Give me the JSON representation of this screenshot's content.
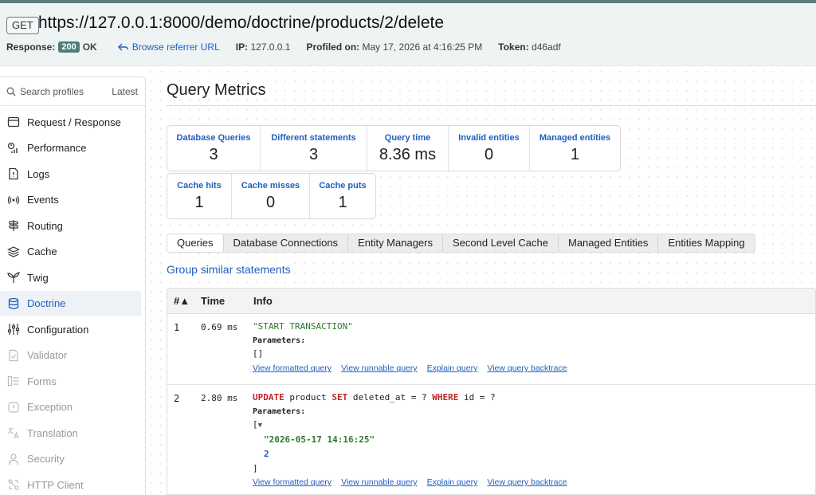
{
  "header": {
    "method": "GET",
    "url": "https://127.0.0.1:8000/demo/doctrine/products/2/delete",
    "response_label": "Response:",
    "status_code": "200",
    "status_text": "OK",
    "referrer_link": "Browse referrer URL",
    "ip_label": "IP:",
    "ip_value": "127.0.0.1",
    "profiled_label": "Profiled on:",
    "profiled_value": "May 17, 2026 at 4:16:25 PM",
    "token_label": "Token:",
    "token_value": "d46adf"
  },
  "sidebar": {
    "search_placeholder": "Search profiles",
    "latest": "Latest",
    "items": [
      {
        "label": "Request / Response",
        "icon": "request-icon",
        "state": "normal"
      },
      {
        "label": "Performance",
        "icon": "performance-icon",
        "state": "normal"
      },
      {
        "label": "Logs",
        "icon": "logs-icon",
        "state": "normal"
      },
      {
        "label": "Events",
        "icon": "events-icon",
        "state": "normal"
      },
      {
        "label": "Routing",
        "icon": "routing-icon",
        "state": "normal"
      },
      {
        "label": "Cache",
        "icon": "cache-icon",
        "state": "normal"
      },
      {
        "label": "Twig",
        "icon": "twig-icon",
        "state": "normal"
      },
      {
        "label": "Doctrine",
        "icon": "database-icon",
        "state": "active"
      },
      {
        "label": "Configuration",
        "icon": "configuration-icon",
        "state": "normal"
      },
      {
        "label": "Validator",
        "icon": "validator-icon",
        "state": "disabled"
      },
      {
        "label": "Forms",
        "icon": "forms-icon",
        "state": "disabled"
      },
      {
        "label": "Exception",
        "icon": "exception-icon",
        "state": "disabled"
      },
      {
        "label": "Translation",
        "icon": "translation-icon",
        "state": "disabled"
      },
      {
        "label": "Security",
        "icon": "security-icon",
        "state": "disabled"
      },
      {
        "label": "HTTP Client",
        "icon": "http-client-icon",
        "state": "disabled"
      }
    ]
  },
  "main": {
    "title": "Query Metrics",
    "metrics_row1": [
      {
        "label": "Database Queries",
        "value": "3"
      },
      {
        "label": "Different statements",
        "value": "3"
      },
      {
        "label": "Query time",
        "value": "8.36 ms"
      },
      {
        "label": "Invalid entities",
        "value": "0"
      },
      {
        "label": "Managed entities",
        "value": "1"
      }
    ],
    "metrics_row2": [
      {
        "label": "Cache hits",
        "value": "1"
      },
      {
        "label": "Cache misses",
        "value": "0"
      },
      {
        "label": "Cache puts",
        "value": "1"
      }
    ],
    "tabs": [
      {
        "label": "Queries",
        "active": true
      },
      {
        "label": "Database Connections",
        "active": false
      },
      {
        "label": "Entity Managers",
        "active": false
      },
      {
        "label": "Second Level Cache",
        "active": false
      },
      {
        "label": "Managed Entities",
        "active": false
      },
      {
        "label": "Entities Mapping",
        "active": false
      }
    ],
    "group_link": "Group similar statements",
    "table": {
      "columns": [
        "#▲",
        "Time",
        "Info"
      ],
      "params_label": "Parameters:",
      "links": [
        "View formatted query",
        "View runnable query",
        "Explain query",
        "View query backtrace"
      ],
      "rows": [
        {
          "num": "1",
          "time": "0.69 ms",
          "sql": "\"START TRANSACTION\"",
          "params": "[]"
        },
        {
          "num": "2",
          "time": "2.80 ms",
          "sql_kw1": "UPDATE",
          "sql_part1": " product ",
          "sql_kw2": "SET",
          "sql_part2": " deleted_at = ? ",
          "sql_kw3": "WHERE",
          "sql_part3": " id = ?",
          "params_open": "[",
          "params_caret": "▼",
          "param_values": [
            "\"2026-05-17 14:16:25\"",
            "2"
          ],
          "params_close": "]"
        }
      ]
    }
  }
}
